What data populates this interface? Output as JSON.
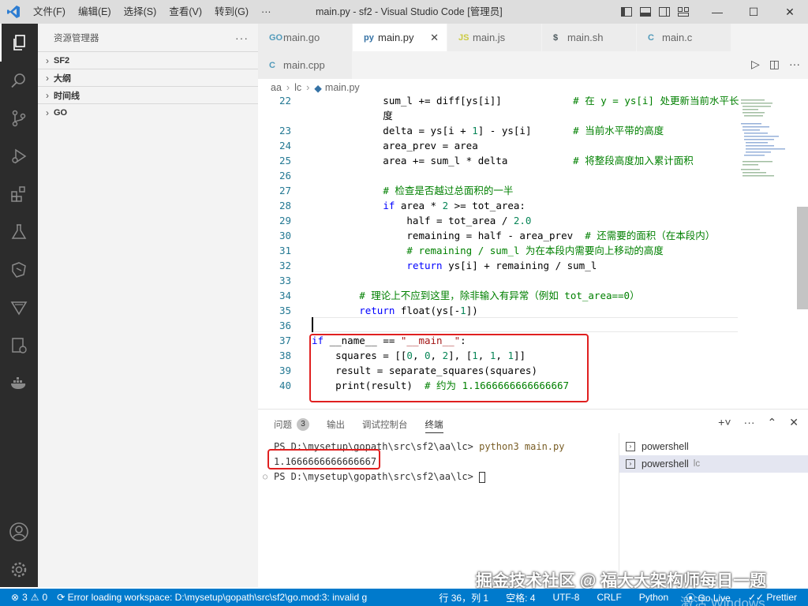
{
  "titlebar": {
    "menus": [
      "文件(F)",
      "编辑(E)",
      "选择(S)",
      "查看(V)",
      "转到(G)",
      "···"
    ],
    "title": "main.py - sf2 - Visual Studio Code [管理员]"
  },
  "sidebar": {
    "header": "资源管理器",
    "sections": [
      "SF2",
      "大纲",
      "时间线",
      "GO"
    ]
  },
  "tabs": [
    {
      "label": "main.go",
      "icon": "GO",
      "icon_color": "#519aba"
    },
    {
      "label": "main.py",
      "icon": "py",
      "icon_color": "#3572a5",
      "active": true
    },
    {
      "label": "main.js",
      "icon": "JS",
      "icon_color": "#cbcb41"
    },
    {
      "label": "main.sh",
      "icon": "$",
      "icon_color": "#4d5a5e"
    },
    {
      "label": "main.c",
      "icon": "C",
      "icon_color": "#519aba"
    },
    {
      "label": "main.cpp",
      "icon": "C",
      "icon_color": "#519aba"
    }
  ],
  "breadcrumb": [
    "aa",
    "lc",
    "main.py"
  ],
  "code": [
    {
      "n": "22",
      "t": "            sum_l += diff[ys[i]]            # 在 y = ys[i] 处更新当前水平长"
    },
    {
      "n": "",
      "t": "            度"
    },
    {
      "n": "23",
      "t": "            delta = ys[i + 1] - ys[i]       # 当前水平带的高度"
    },
    {
      "n": "24",
      "t": "            area_prev = area"
    },
    {
      "n": "25",
      "t": "            area += sum_l * delta           # 将整段高度加入累计面积"
    },
    {
      "n": "26",
      "t": ""
    },
    {
      "n": "27",
      "t": "            # 检查是否越过总面积的一半"
    },
    {
      "n": "28",
      "t": "            if area * 2 >= tot_area:"
    },
    {
      "n": "29",
      "t": "                half = tot_area / 2.0"
    },
    {
      "n": "30",
      "t": "                remaining = half - area_prev  # 还需要的面积（在本段内）"
    },
    {
      "n": "31",
      "t": "                # remaining / sum_l 为在本段内需要向上移动的高度"
    },
    {
      "n": "32",
      "t": "                return ys[i] + remaining / sum_l"
    },
    {
      "n": "33",
      "t": ""
    },
    {
      "n": "34",
      "t": "        # 理论上不应到这里，除非输入有异常（例如 tot_area==0）"
    },
    {
      "n": "35",
      "t": "        return float(ys[-1])"
    },
    {
      "n": "36",
      "t": ""
    },
    {
      "n": "37",
      "t": "if __name__ == \"__main__\":"
    },
    {
      "n": "38",
      "t": "    squares = [[0, 0, 2], [1, 1, 1]]"
    },
    {
      "n": "39",
      "t": "    result = separate_squares(squares)"
    },
    {
      "n": "40",
      "t": "    print(result)  # 约为 1.1666666666666667"
    }
  ],
  "panel": {
    "tabs": [
      "问题",
      "输出",
      "调试控制台",
      "终端"
    ],
    "problems_count": "3",
    "terminal_lines": [
      "PS D:\\mysetup\\gopath\\src\\sf2\\aa\\lc> python3 main.py",
      "1.1666666666666667",
      "PS D:\\mysetup\\gopath\\src\\sf2\\aa\\lc> "
    ],
    "terminals": [
      {
        "label": "powershell",
        "sub": ""
      },
      {
        "label": "powershell",
        "sub": "lc"
      }
    ]
  },
  "statusbar": {
    "errors": "3",
    "warnings": "0",
    "message": "Error loading workspace: D:\\mysetup\\gopath\\src\\sf2\\go.mod:3: invalid g",
    "position": "行 36，列 1",
    "spaces": "空格: 4",
    "encoding": "UTF-8",
    "eol": "CRLF",
    "language": "Python",
    "golive": "Go Live",
    "prettier": "Prettier"
  },
  "watermark": "掘金技术社区 @ 福大大架构师每日一题",
  "activation_text": "激活 Windows",
  "colors": {
    "accent": "#007acc",
    "highlight": "#e02020"
  }
}
